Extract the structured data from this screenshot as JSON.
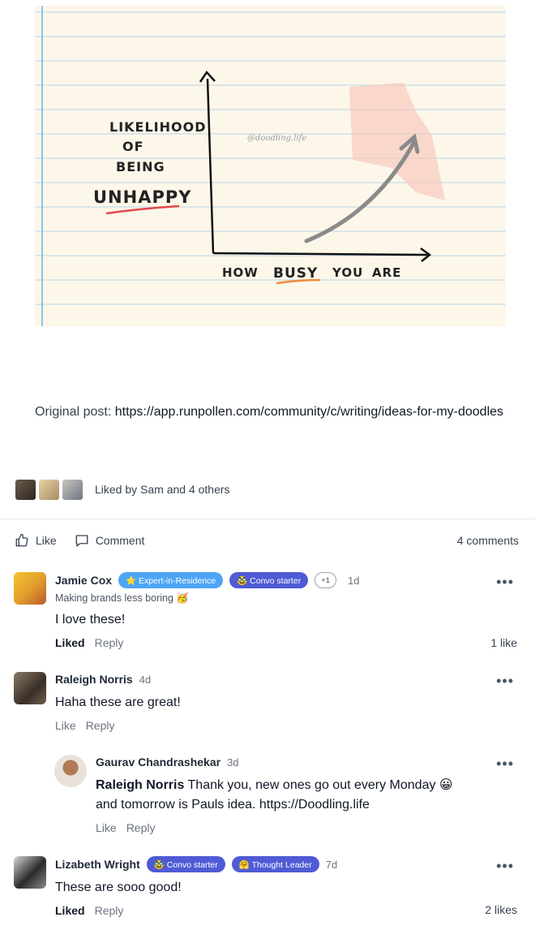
{
  "doodle": {
    "ylabel": [
      "LIKELIHOOD",
      "OF",
      "BEING"
    ],
    "ylabel_emphasis": "UNHAPPY",
    "xlabel_parts": [
      "HOW",
      "BUSY",
      "YOU",
      "ARE"
    ],
    "watermark": "@doodling.life"
  },
  "post": {
    "original_label": "Original post:",
    "original_url": "https://app.runpollen.com/community/c/writing/ideas-for-my-doodles",
    "liked_by": "Liked by Sam and 4 others"
  },
  "actions": {
    "like_label": "Like",
    "comment_label": "Comment",
    "comment_count": "4 comments"
  },
  "comments": [
    {
      "name": "Jamie Cox",
      "badges": [
        "⭐ Expert-in-Residence",
        "🥸 Convo starter",
        "+1"
      ],
      "time": "1d",
      "headline": "Making brands less boring 🥳",
      "text": "I love these!",
      "like_label": "Liked",
      "reply_label": "Reply",
      "likes": "1 like"
    },
    {
      "name": "Raleigh Norris",
      "time": "4d",
      "text": "Haha these are great!",
      "like_label": "Like",
      "reply_label": "Reply"
    },
    {
      "name": "Gaurav Chandrashekar",
      "time": "3d",
      "mention": "Raleigh Norris",
      "text_line1": " Thank you, new ones go out every Monday 😀",
      "text_line2": "and tomorrow is Pauls idea. https://Doodling.life",
      "like_label": "Like",
      "reply_label": "Reply"
    },
    {
      "name": "Lizabeth Wright",
      "badges": [
        "🥸 Convo starter",
        "🤗 Thought Leader"
      ],
      "time": "7d",
      "text": "These are sooo good!",
      "like_label": "Liked",
      "reply_label": "Reply",
      "likes": "2 likes"
    }
  ],
  "more_glyph": "•••",
  "colors": {
    "paper": "#fdf7ea",
    "rule_line": "#b8d4e8",
    "margin_line": "#8ec3e6",
    "badge_blue": "#4ea5f5",
    "badge_indigo": "#4f5bd5"
  }
}
